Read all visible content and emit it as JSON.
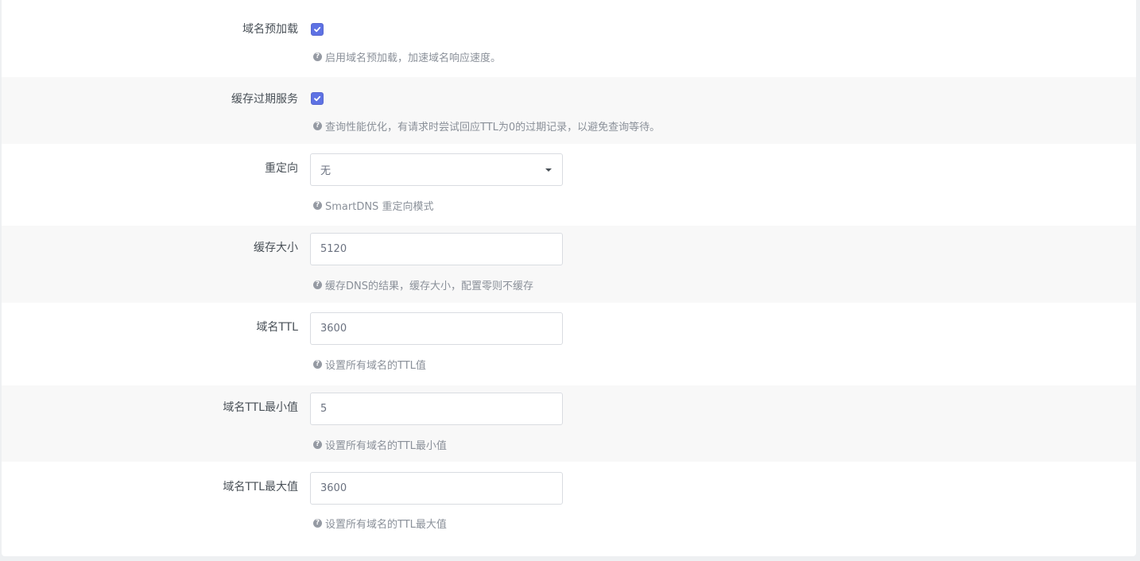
{
  "rows": [
    {
      "label": "域名预加载",
      "type": "checkbox",
      "checked": true,
      "help": "启用域名预加载，加速域名响应速度。"
    },
    {
      "label": "缓存过期服务",
      "type": "checkbox",
      "checked": true,
      "help": "查询性能优化，有请求时尝试回应TTL为0的过期记录，以避免查询等待。"
    },
    {
      "label": "重定向",
      "type": "select",
      "value": "无",
      "help": "SmartDNS 重定向模式"
    },
    {
      "label": "缓存大小",
      "type": "input",
      "value": "5120",
      "help": "缓存DNS的结果，缓存大小，配置零则不缓存"
    },
    {
      "label": "域名TTL",
      "type": "input",
      "value": "3600",
      "help": "设置所有域名的TTL值"
    },
    {
      "label": "域名TTL最小值",
      "type": "input",
      "value": "5",
      "help": "设置所有域名的TTL最小值"
    },
    {
      "label": "域名TTL最大值",
      "type": "input",
      "value": "3600",
      "help": "设置所有域名的TTL最大值"
    }
  ],
  "icons": {
    "help": "question-circle-icon",
    "check": "check-icon",
    "caret": "caret-down-icon"
  },
  "colors": {
    "accent": "#5e72e4",
    "label": "#495057",
    "help": "#8a9099",
    "alt_row": "#f8f8f8"
  }
}
